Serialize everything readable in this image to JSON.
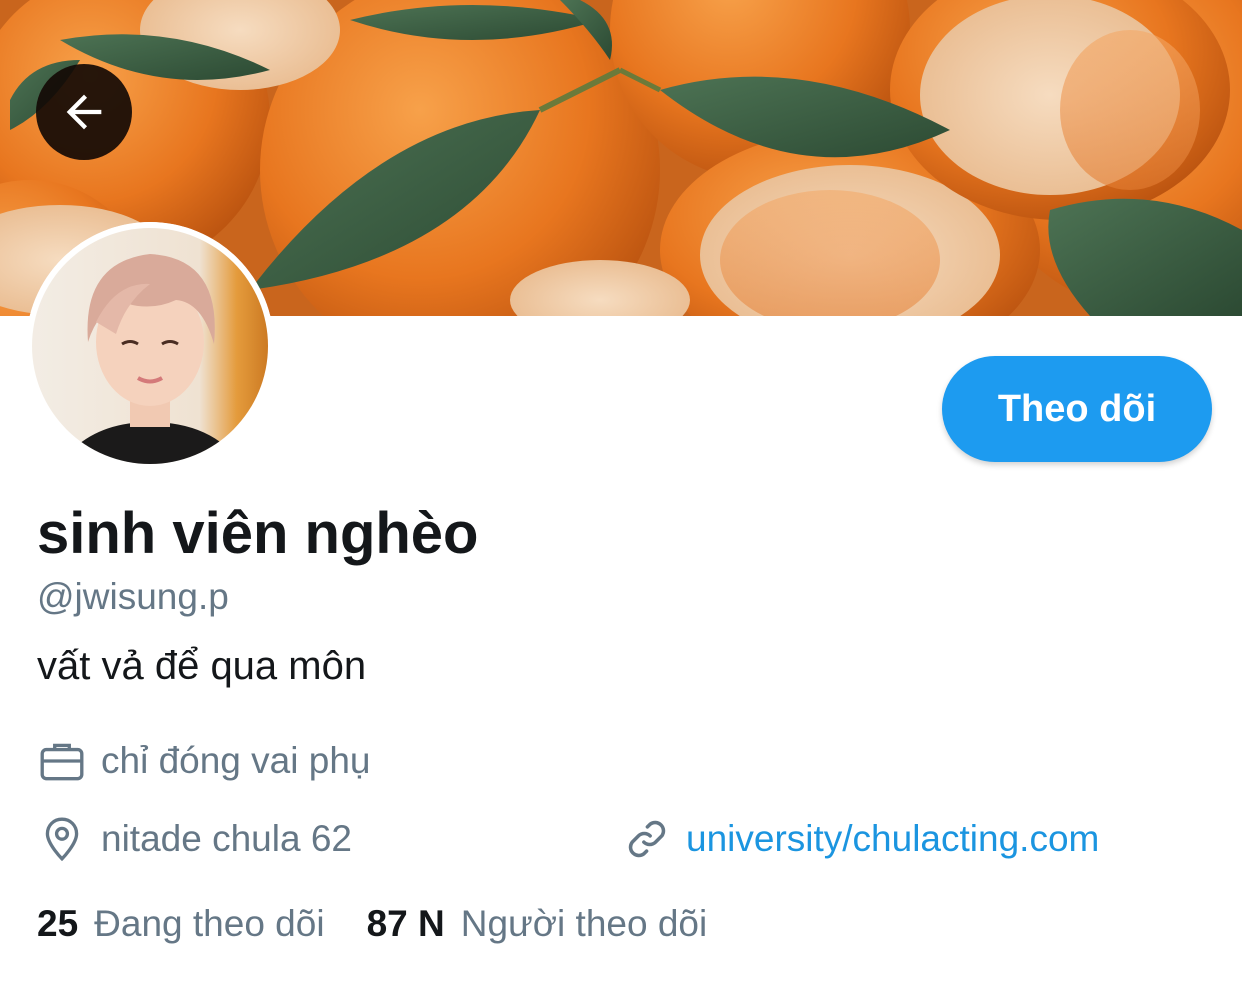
{
  "header": {
    "back_icon": "arrow-left-icon"
  },
  "profile": {
    "display_name": "sinh viên nghèo",
    "handle": "@jwisung.p",
    "bio": "vất vả để qua môn",
    "job": "chỉ đóng vai phụ",
    "job_icon": "briefcase-icon",
    "location": "nitade chula 62",
    "location_icon": "location-pin-icon",
    "website": "university/chulacting.com",
    "website_icon": "link-icon"
  },
  "actions": {
    "follow_label": "Theo dõi"
  },
  "stats": {
    "following_count": "25",
    "following_label": "Đang theo dõi",
    "followers_count": "87 N",
    "followers_label": "Người theo dõi"
  },
  "colors": {
    "accent": "#1d9bf0",
    "link": "#1b95e0",
    "text_primary": "#14171a",
    "text_secondary": "#657786",
    "banner_orange": "#e5782a",
    "leaf_green": "#3b5e43"
  }
}
